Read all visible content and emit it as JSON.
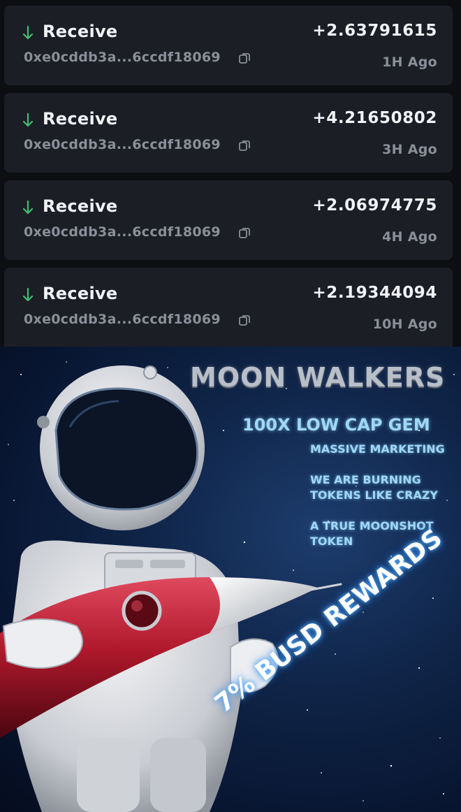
{
  "transactions": [
    {
      "type": "Receive",
      "amount": "+2.63791615",
      "address": "0xe0cddb3a...6ccdf18069",
      "time": "1H Ago"
    },
    {
      "type": "Receive",
      "amount": "+4.21650802",
      "address": "0xe0cddb3a...6ccdf18069",
      "time": "3H Ago"
    },
    {
      "type": "Receive",
      "amount": "+2.06974775",
      "address": "0xe0cddb3a...6ccdf18069",
      "time": "4H Ago"
    },
    {
      "type": "Receive",
      "amount": "+2.19344094",
      "address": "0xe0cddb3a...6ccdf18069",
      "time": "10H Ago"
    }
  ],
  "icons": {
    "receive": "arrow-down-icon",
    "copy": "copy-icon"
  },
  "colors": {
    "receive_arrow": "#3fbf6f",
    "card_bg": "#1b1e25",
    "page_bg": "#0c0e12",
    "muted_text": "#8a8f99",
    "banner_text": "#9fd8f6"
  },
  "banner": {
    "title": "MOON WALKERS",
    "headline": "100X LOW CAP GEM",
    "bullets": [
      "MASSIVE MARKETING",
      "WE ARE BURNING\nTOKENS LIKE CRAZY",
      "A TRUE MOONSHOT\nTOKEN"
    ],
    "rewards": "7% BUSD REWARDS"
  }
}
